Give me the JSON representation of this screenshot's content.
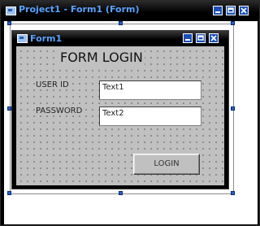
{
  "outer_window": {
    "title": "Project1 - Form1 (Form)"
  },
  "form_window": {
    "title": "Form1"
  },
  "form": {
    "heading": "FORM LOGIN",
    "user_id_label": "USER ID",
    "password_label": "PASSWORD",
    "user_id_value": "Text1",
    "password_value": "Text2",
    "login_button_label": "LOGIN"
  },
  "icons": {
    "app": "form-app-icon",
    "minimize": "minimize-icon",
    "restore": "restore-icon",
    "close": "close-icon"
  },
  "colors": {
    "title_text": "#5aa2ff",
    "title_buttons": "#1b4fb8",
    "form_background": "#c0c0c0",
    "selection_handles": "#2563c7"
  }
}
